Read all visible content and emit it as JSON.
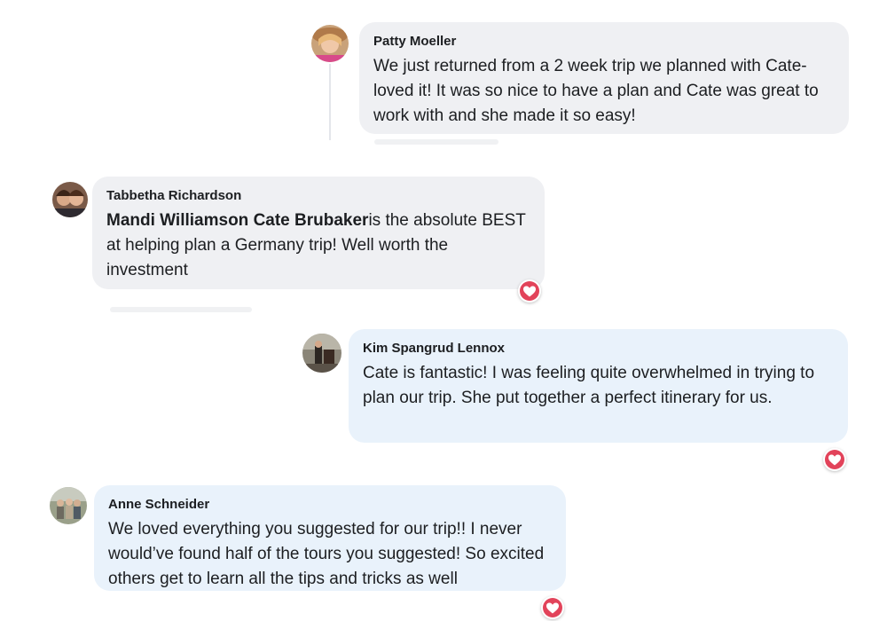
{
  "comments": [
    {
      "author": "Patty Moeller",
      "text": "We just returned from a 2 week trip we planned with Cate-loved it! It was so nice to have a plan and Cate was great to work with and she made it so easy!"
    },
    {
      "author": "Tabbetha Richardson",
      "mention": "Mandi Williamson Cate Brubaker",
      "text": "is the absolute BEST at helping plan a Germany trip! Well worth the investment",
      "reaction": "heart-icon"
    },
    {
      "author": "Kim Spangrud Lennox",
      "text": "Cate is fantastic! I was feeling quite overwhelmed in trying to plan our trip. She put together a perfect itinerary for us.",
      "reaction": "heart-icon"
    },
    {
      "author": "Anne Schneider",
      "text": "We loved everything you suggested for our trip!! I never would’ve found half of the tours you suggested! So excited others get to learn all the tips and tricks as well",
      "reaction": "heart-icon"
    }
  ],
  "colors": {
    "bubble_gray": "#eff0f3",
    "bubble_blue": "#e9f2fb",
    "heart": "#e2435a"
  }
}
